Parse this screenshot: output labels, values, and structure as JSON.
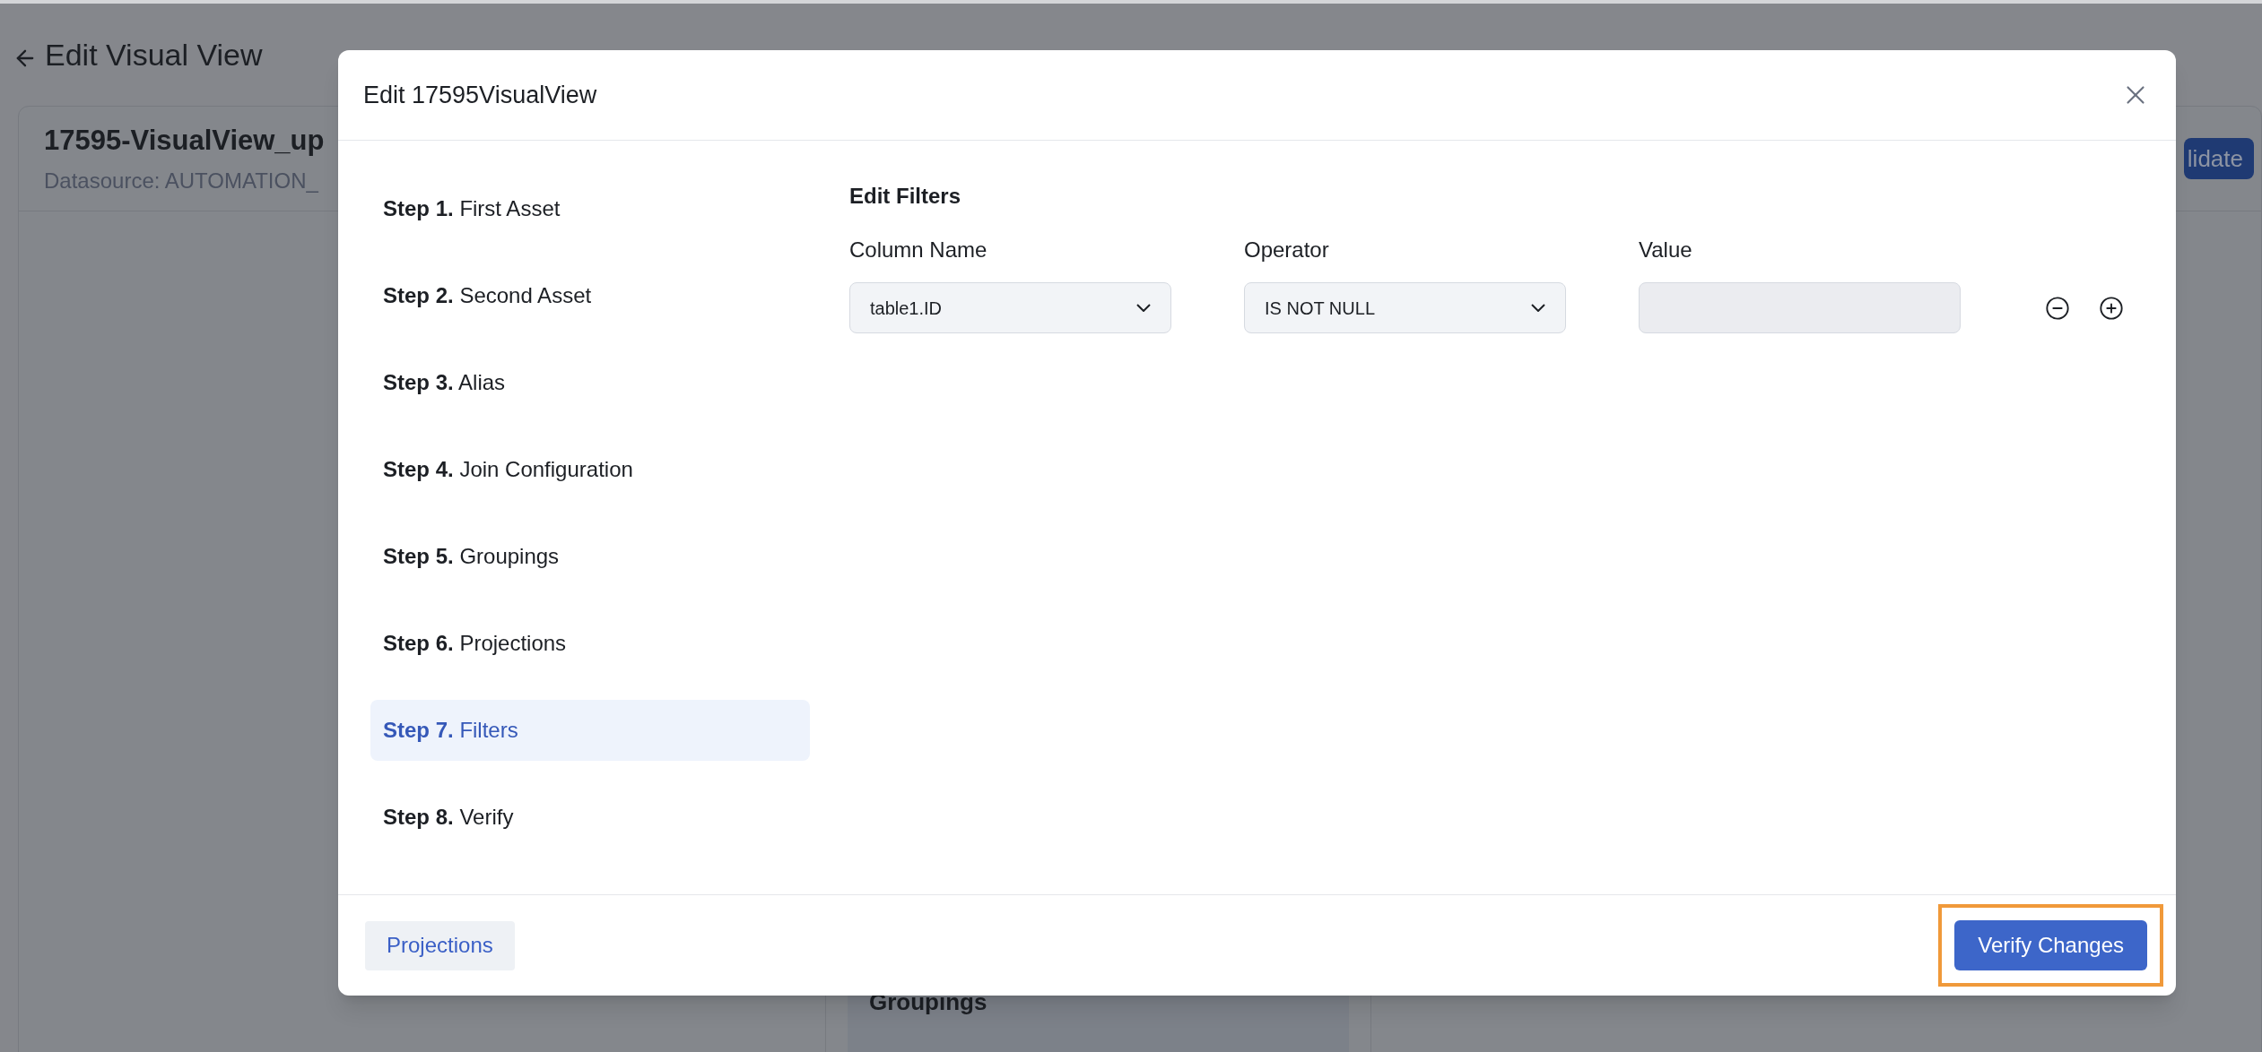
{
  "page": {
    "title": "Edit Visual View"
  },
  "card": {
    "title": "17595-VisualView_up",
    "subtitle": "Datasource: AUTOMATION_",
    "button": "lidate"
  },
  "background_panel": {
    "title": "Groupings"
  },
  "dialog": {
    "title": "Edit 17595VisualView",
    "steps": [
      {
        "number": "Step 1.",
        "label": "First Asset",
        "selected": false
      },
      {
        "number": "Step 2.",
        "label": "Second Asset",
        "selected": false
      },
      {
        "number": "Step 3.",
        "label": "Alias",
        "selected": false
      },
      {
        "number": "Step 4.",
        "label": "Join Configuration",
        "selected": false
      },
      {
        "number": "Step 5.",
        "label": "Groupings",
        "selected": false
      },
      {
        "number": "Step 6.",
        "label": "Projections",
        "selected": false
      },
      {
        "number": "Step 7.",
        "label": "Filters",
        "selected": true
      },
      {
        "number": "Step 8.",
        "label": "Verify",
        "selected": false
      }
    ],
    "section_title": "Edit Filters",
    "columns": [
      "Column Name",
      "Operator",
      "Value"
    ],
    "filters": [
      {
        "column": "table1.ID",
        "operator": "IS NOT NULL",
        "value_disabled": true
      }
    ],
    "footer": {
      "back_button": "Projections",
      "primary_button": {
        "label": "Verify Changes",
        "highlighted": true
      }
    }
  }
}
